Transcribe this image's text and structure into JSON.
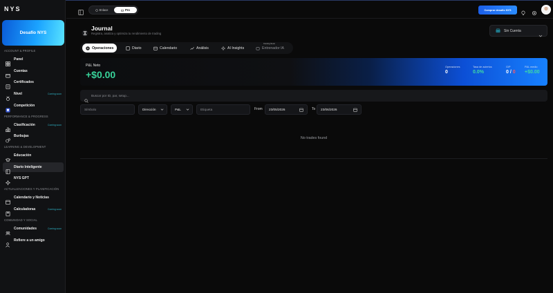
{
  "app": {
    "logo": "NYS"
  },
  "sidebar": {
    "promo": "Desafío NYS",
    "sections": [
      {
        "title": "ACCOUNT & PROFILE"
      },
      {
        "title": "PERFORMANCE & PROGRESS"
      },
      {
        "title": "LEARNING & DEVELOPMENT"
      },
      {
        "title": "ACTUALIZACIONES Y PLANIFICACIÓN"
      },
      {
        "title": "COMUNIDAD Y SOCIAL"
      }
    ],
    "items": [
      {
        "label": "Panel",
        "icon": "grid-icon"
      },
      {
        "label": "Cuentas",
        "icon": "wallet-icon"
      },
      {
        "label": "Certificados",
        "icon": "certificate-icon"
      },
      {
        "label": "Nivel",
        "icon": "medal-icon",
        "badge": "Coming soon"
      },
      {
        "label": "Competición",
        "icon": "trophy-icon"
      },
      {
        "label": "Clasificación",
        "icon": "ranking-icon",
        "badge": "Coming soon"
      },
      {
        "label": "Burbujas",
        "icon": "bubbles-icon"
      },
      {
        "label": "Educación",
        "icon": "graduation-cap-icon"
      },
      {
        "label": "Diario Inteligente",
        "icon": "book-icon"
      },
      {
        "label": "NYS GPT",
        "icon": "ai-spark-icon"
      },
      {
        "label": "Calendario y Noticias",
        "icon": "calendar-icon"
      },
      {
        "label": "Calculadoras",
        "icon": "calculator-icon",
        "badge": "Coming soon"
      },
      {
        "label": "Comunidades",
        "icon": "community-icon",
        "badge": "Coming soon"
      },
      {
        "label": "Refiere a un amigo",
        "icon": "user-plus-icon"
      }
    ]
  },
  "topbar": {
    "segment": [
      {
        "label": "Enlace"
      },
      {
        "label": "Pro"
      }
    ],
    "cta": "Comprar desafío NYS"
  },
  "journal": {
    "title": "Journal",
    "subtitle": "Registra, analiza y optimiza tu rendimiento de trading",
    "account_select": "Sin Cuenta",
    "tabs": [
      {
        "label": "Operaciones"
      },
      {
        "label": "Diario"
      },
      {
        "label": "Calendario"
      },
      {
        "label": "Análisis"
      },
      {
        "label": "AI Insights"
      },
      {
        "label": "Entrenador IA",
        "tag": "Coming Soon"
      }
    ],
    "pnl": {
      "label": "P&L Neto",
      "value": "+$0.00",
      "stats": [
        {
          "key": "Operaciones",
          "value": "0"
        },
        {
          "key": "Tasa de aciertos",
          "value": "0.0%"
        },
        {
          "key": "G/P",
          "value_a": "0",
          "value_sep": " / ",
          "value_b": "0"
        },
        {
          "key": "P&L medio",
          "value": "+$0.00"
        }
      ]
    },
    "search_placeholder": "Buscar por ID, par, setup...",
    "filters": {
      "symbol_placeholder": "Símbolo",
      "direction": "Dirección",
      "pnl": "P&L",
      "tag_placeholder": "Etiqueta",
      "from_label": "From",
      "from_date": "23/05/2026",
      "to_label": "To",
      "to_date": "23/06/2026"
    },
    "empty": "No trades found"
  },
  "colors": {
    "accent": "#1c6ff0",
    "positive": "#38d39a",
    "negative": "#ff5a63"
  }
}
